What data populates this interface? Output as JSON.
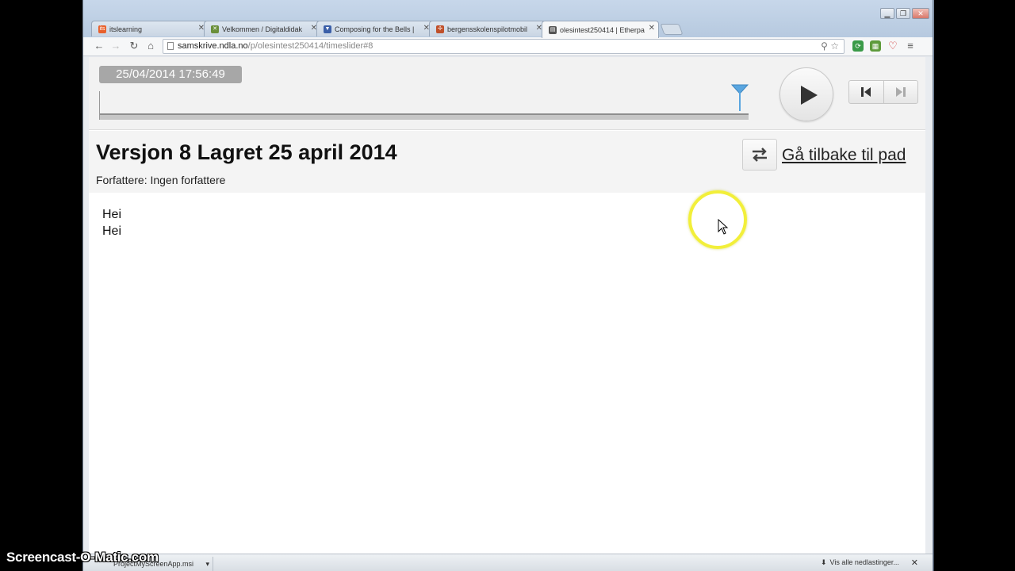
{
  "browser": {
    "tabs": [
      {
        "label": "itslearning",
        "favicon": "itslearning-icon",
        "color": "#e8602c",
        "active": false
      },
      {
        "label": "Velkommen / Digitaldidak",
        "favicon": "crossed-tools-icon",
        "color": "#6a8f3a",
        "active": false
      },
      {
        "label": "Composing for the Bells |",
        "favicon": "shield-icon",
        "color": "#3b5fa8",
        "active": false
      },
      {
        "label": "bergensskolenspilotmobil",
        "favicon": "pinwheel-icon",
        "color": "#c0502a",
        "active": false
      },
      {
        "label": "olesintest250414 | Etherpa",
        "favicon": "clipboard-icon",
        "color": "#555555",
        "active": true
      }
    ],
    "url": {
      "host": "samskrive.ndla.no",
      "path": "/p/olesintest250414/timeslider#8"
    }
  },
  "timeslider": {
    "timestamp": "25/04/2014 17:56:49",
    "position": 1.0
  },
  "revision": {
    "title": "Versjon 8 Lagret 25 april 2014",
    "authors": "Forfattere: Ingen forfattere",
    "return_link": "Gå tilbake til pad"
  },
  "pad": {
    "lines": [
      "Hei",
      "Hei"
    ]
  },
  "downloads": {
    "file": "ProjectMyScreenApp.msi",
    "show_all": "Vis alle nedlastinger..."
  },
  "watermark": "Screencast-O-Matic.com",
  "colors": {
    "slider_handle": "#5aa6e0",
    "cursor_highlight": "#f2ef3a"
  }
}
